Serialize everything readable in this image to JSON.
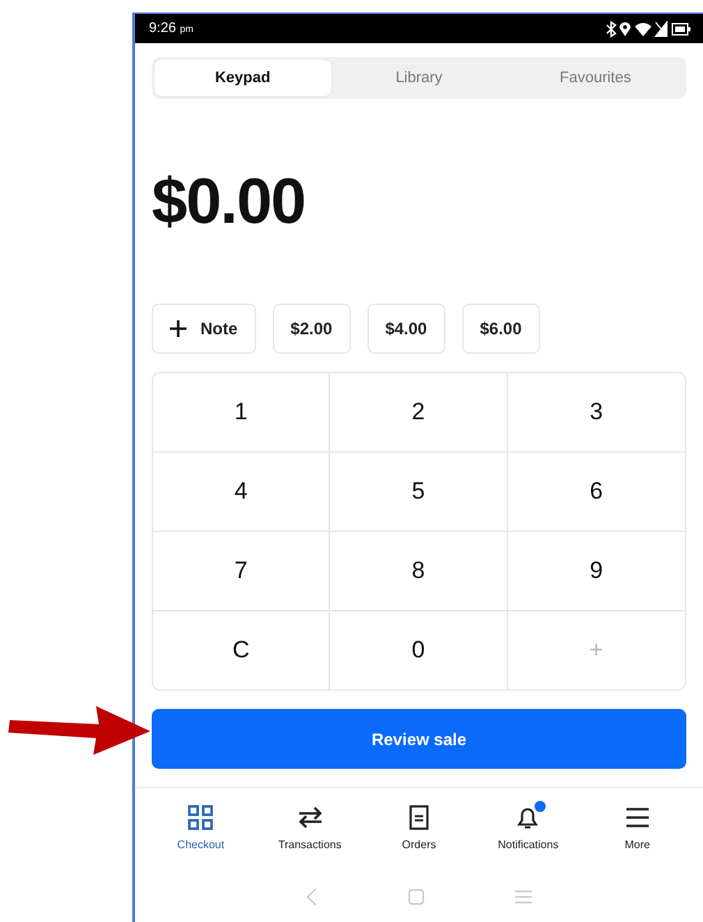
{
  "status_bar": {
    "time": "9:26",
    "time_suffix": "pm"
  },
  "tabs": [
    {
      "label": "Keypad",
      "selected": true
    },
    {
      "label": "Library",
      "selected": false
    },
    {
      "label": "Favourites",
      "selected": false
    }
  ],
  "amount": "$0.00",
  "quick_actions": [
    {
      "kind": "note",
      "label": "Note"
    },
    {
      "kind": "amount",
      "label": "$2.00"
    },
    {
      "kind": "amount",
      "label": "$4.00"
    },
    {
      "kind": "amount",
      "label": "$6.00"
    }
  ],
  "keypad": [
    {
      "label": "1",
      "disabled": false
    },
    {
      "label": "2",
      "disabled": false
    },
    {
      "label": "3",
      "disabled": false
    },
    {
      "label": "4",
      "disabled": false
    },
    {
      "label": "5",
      "disabled": false
    },
    {
      "label": "6",
      "disabled": false
    },
    {
      "label": "7",
      "disabled": false
    },
    {
      "label": "8",
      "disabled": false
    },
    {
      "label": "9",
      "disabled": false
    },
    {
      "label": "C",
      "disabled": false
    },
    {
      "label": "0",
      "disabled": false
    },
    {
      "label": "+",
      "disabled": true
    }
  ],
  "primary_button": "Review sale",
  "bottom_nav": [
    {
      "kind": "grid",
      "label": "Checkout",
      "selected": true,
      "badge": false
    },
    {
      "kind": "swap",
      "label": "Transactions",
      "selected": false,
      "badge": false
    },
    {
      "kind": "receipt",
      "label": "Orders",
      "selected": false,
      "badge": false
    },
    {
      "kind": "bell",
      "label": "Notifications",
      "selected": false,
      "badge": true
    },
    {
      "kind": "menu",
      "label": "More",
      "selected": false,
      "badge": false
    }
  ]
}
